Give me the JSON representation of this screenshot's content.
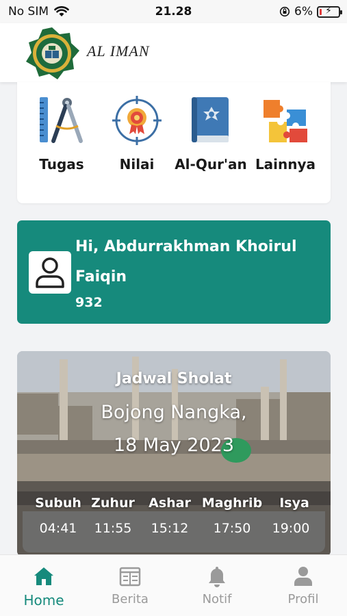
{
  "status_bar": {
    "carrier": "No SIM",
    "time": "21.28",
    "battery_percent": "6%"
  },
  "header": {
    "brand": "AL IMAN",
    "logo_icon": "school-emblem-icon"
  },
  "menu": {
    "items": [
      {
        "label": "Tugas",
        "icon": "ruler-compass-icon"
      },
      {
        "label": "Nilai",
        "icon": "award-target-icon"
      },
      {
        "label": "Al-Qur'an",
        "icon": "quran-book-icon"
      },
      {
        "label": "Lainnya",
        "icon": "puzzle-icon"
      }
    ]
  },
  "greeting": {
    "name": "Hi, Abdurrakhman Khoirul Faiqin",
    "id": "932",
    "avatar_icon": "user-icon"
  },
  "prayer": {
    "title": "Jadwal Sholat",
    "location": "Bojong Nangka,",
    "date": "18 May 2023",
    "times": [
      {
        "name": "Subuh",
        "time": "04:41"
      },
      {
        "name": "Zuhur",
        "time": "11:55"
      },
      {
        "name": "Ashar",
        "time": "15:12"
      },
      {
        "name": "Maghrib",
        "time": "17:50"
      },
      {
        "name": "Isya",
        "time": "19:00"
      }
    ]
  },
  "nav": {
    "items": [
      {
        "label": "Home",
        "icon": "home-icon",
        "active": true
      },
      {
        "label": "Berita",
        "icon": "news-icon",
        "active": false
      },
      {
        "label": "Notif",
        "icon": "bell-icon",
        "active": false
      },
      {
        "label": "Profil",
        "icon": "user-icon",
        "active": false
      }
    ]
  },
  "colors": {
    "accent": "#168a7c",
    "inactive": "#9a9a9a"
  }
}
